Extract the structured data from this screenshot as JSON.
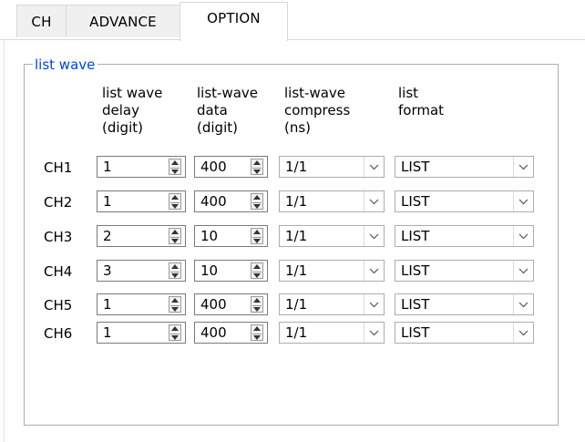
{
  "tabs": [
    {
      "label": "CH"
    },
    {
      "label": "ADVANCE"
    },
    {
      "label": "OPTION",
      "active": true
    }
  ],
  "group": {
    "title": "list wave"
  },
  "headers": {
    "delay": "list wave\ndelay\n(digit)",
    "data": "list-wave\ndata\n(digit)",
    "compress": "list-wave\ncompress\n(ns)",
    "format": "list\nformat"
  },
  "rows": [
    {
      "ch": "CH1",
      "delay": "1",
      "data": "400",
      "compress": "1/1",
      "format": "LIST"
    },
    {
      "ch": "CH2",
      "delay": "1",
      "data": "400",
      "compress": "1/1",
      "format": "LIST"
    },
    {
      "ch": "CH3",
      "delay": "2",
      "data": "10",
      "compress": "1/1",
      "format": "LIST"
    },
    {
      "ch": "CH4",
      "delay": "3",
      "data": "10",
      "compress": "1/1",
      "format": "LIST"
    },
    {
      "ch": "CH5",
      "delay": "1",
      "data": "400",
      "compress": "1/1",
      "format": "LIST"
    },
    {
      "ch": "CH6",
      "delay": "1",
      "data": "400",
      "compress": "1/1",
      "format": "LIST"
    }
  ],
  "colors": {
    "group_title": "#0046d5",
    "active_tab_bg": "#ffffff",
    "inactive_tab_bg": "#f0f0f0"
  }
}
